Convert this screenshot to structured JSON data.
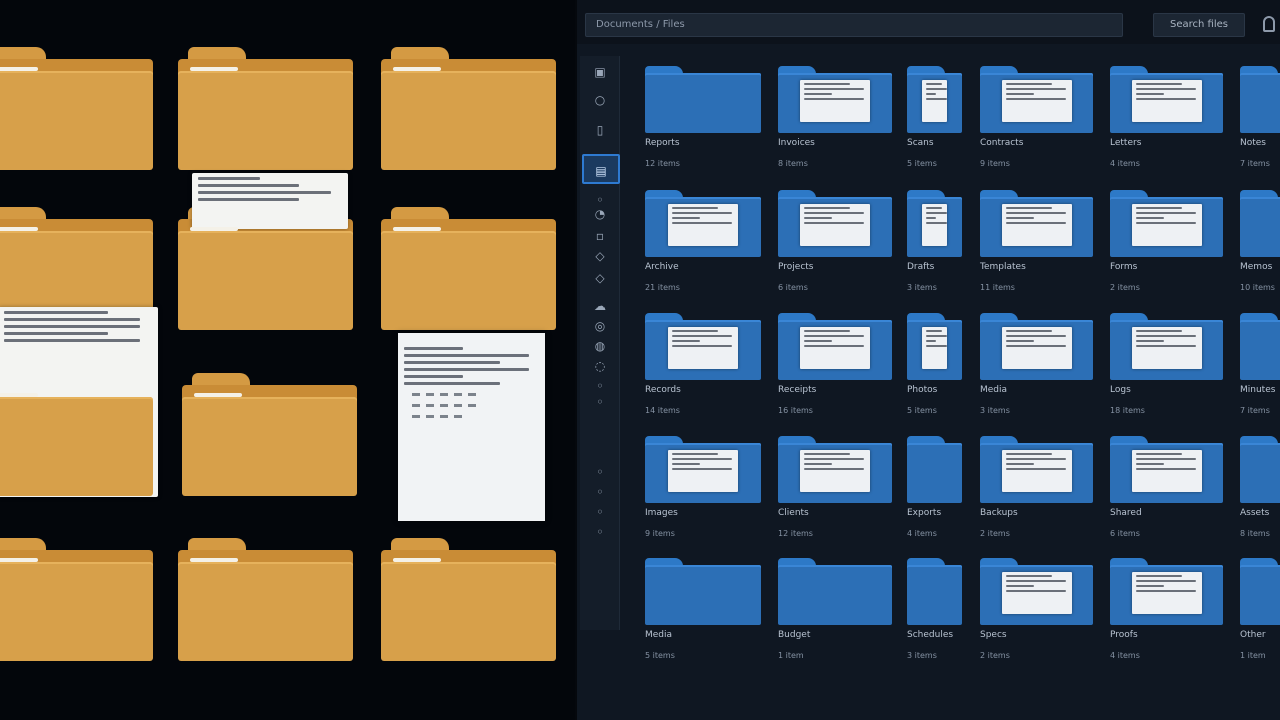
{
  "explorer": {
    "path_text": "Documents / Files",
    "search_label": "Search files",
    "user_icon": "user-icon",
    "accent_color": "#2e7ad1",
    "folder_color": "#2c6fb6"
  },
  "sidebar": {
    "items": [
      {
        "icon": "image-icon",
        "glyph": "▣"
      },
      {
        "icon": "circle-icon",
        "glyph": "○"
      },
      {
        "icon": "document-icon",
        "glyph": "▯"
      },
      {
        "icon": "folder-icon",
        "glyph": "▤",
        "active": true
      },
      {
        "icon": "settings-icon",
        "glyph": "◦"
      },
      {
        "icon": "clock-icon",
        "glyph": "◔"
      },
      {
        "icon": "bookmark-icon",
        "glyph": "▫"
      },
      {
        "icon": "share-icon",
        "glyph": "◇"
      },
      {
        "icon": "tag-icon",
        "glyph": "◇"
      },
      {
        "icon": "cloud-icon",
        "glyph": "☁"
      },
      {
        "icon": "lock-icon",
        "glyph": "◎"
      },
      {
        "icon": "trash-icon",
        "glyph": "◍"
      },
      {
        "icon": "star-icon",
        "glyph": "◌"
      },
      {
        "icon": "link-icon",
        "glyph": "◦"
      },
      {
        "icon": "info-icon",
        "glyph": "◦"
      },
      {
        "icon": "help-icon",
        "glyph": "◦"
      },
      {
        "icon": "download-icon",
        "glyph": "◦"
      },
      {
        "icon": "upload-icon",
        "glyph": "◦"
      },
      {
        "icon": "archive-icon",
        "glyph": "◦"
      }
    ]
  },
  "folders": [
    {
      "name": "Reports",
      "sub": "12 items"
    },
    {
      "name": "Invoices",
      "sub": "8 items"
    },
    {
      "name": "Scans",
      "sub": "5 items"
    },
    {
      "name": "Contracts",
      "sub": "9 items"
    },
    {
      "name": "Letters",
      "sub": "4 items"
    },
    {
      "name": "Notes",
      "sub": "7 items"
    },
    {
      "name": "Archive",
      "sub": "21 items"
    },
    {
      "name": "Projects",
      "sub": "6 items"
    },
    {
      "name": "Drafts",
      "sub": "3 items"
    },
    {
      "name": "Templates",
      "sub": "11 items"
    },
    {
      "name": "Forms",
      "sub": "2 items"
    },
    {
      "name": "Memos",
      "sub": "10 items"
    },
    {
      "name": "Records",
      "sub": "14 items"
    },
    {
      "name": "Receipts",
      "sub": "16 items"
    },
    {
      "name": "Photos",
      "sub": "5 items"
    },
    {
      "name": "Media",
      "sub": "3 items"
    },
    {
      "name": "Logs",
      "sub": "18 items"
    },
    {
      "name": "Minutes",
      "sub": "7 items"
    },
    {
      "name": "Images",
      "sub": "9 items"
    },
    {
      "name": "Clients",
      "sub": "12 items"
    },
    {
      "name": "Exports",
      "sub": "4 items"
    },
    {
      "name": "Backups",
      "sub": "2 items"
    },
    {
      "name": "Shared",
      "sub": "6 items"
    },
    {
      "name": "Assets",
      "sub": "8 items"
    },
    {
      "name": "Media",
      "sub": "5 items"
    },
    {
      "name": "Budget",
      "sub": "1 item"
    },
    {
      "name": "Schedules",
      "sub": "3 items"
    },
    {
      "name": "Specs",
      "sub": "2 items"
    },
    {
      "name": "Proofs",
      "sub": "4 items"
    },
    {
      "name": "Other",
      "sub": "1 item"
    }
  ]
}
